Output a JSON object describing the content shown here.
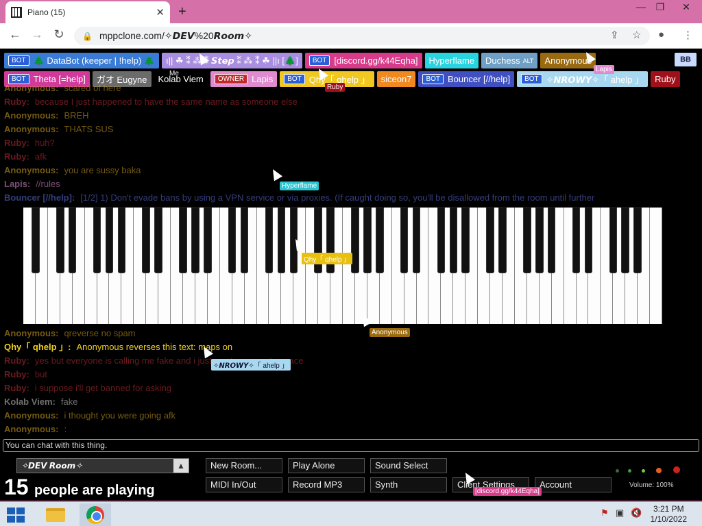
{
  "browser": {
    "tab_title": "Piano (15)",
    "tab_close": "✕",
    "new_tab": "+",
    "url": "mppclone.com/✧𝘿𝙀𝙑%20𝙍𝙤𝙤𝙢✧",
    "window_controls": [
      "—",
      "❐",
      "✕"
    ]
  },
  "players": {
    "row1": [
      {
        "bot": true,
        "name": "🌲 DataBot (keeper | !help) 🌲",
        "color": "#3a7bd5"
      },
      {
        "bot": false,
        "name": "ı|| ☘ ⁑ ⁂ ⁑ 𝙎𝙩𝙚𝙥 ⁑ ⁂ ⁑ ☘ ||ı [🌲]",
        "color": "#a98de0"
      },
      {
        "bot": true,
        "name": "[discord.gg/k44Eqha]",
        "color": "#d83b8a"
      },
      {
        "bot": false,
        "name": "Hyperflame",
        "color": "#29d4e0"
      },
      {
        "bot": false,
        "name": "Duchess",
        "small": "ALT",
        "color": "#6f9fc4"
      },
      {
        "bot": false,
        "name": "Anonymous",
        "color": "#9a6a10"
      }
    ],
    "row2": [
      {
        "bot": true,
        "name": "Theta [=help]",
        "color": "#d03a9a"
      },
      {
        "bot": false,
        "name": "ガオ Eugyne",
        "color": "#6b6b6b"
      },
      {
        "bot": false,
        "name": "Kolab Viem",
        "color": "#000000"
      },
      {
        "bot": false,
        "owner": true,
        "name": "Lapis",
        "color": "#e08ad0"
      },
      {
        "bot": true,
        "name": "Qhy「 qhelp 」",
        "color": "#f0c820"
      },
      {
        "bot": false,
        "name": "siceon7",
        "color": "#f08a20"
      },
      {
        "bot": true,
        "name": "Bouncer [//help]",
        "color": "#4050c0"
      },
      {
        "bot": true,
        "name": "✧𝙉𝙍𝙊𝙒𝙔✧「 ahelp 」",
        "color": "#a8d8f0"
      },
      {
        "bot": false,
        "name": "Ruby",
        "color": "#a0101a"
      }
    ],
    "bot_tag": "BOT",
    "owner_tag": "OWNER",
    "bb_button": "BB"
  },
  "chat": [
    {
      "name": "Anonymous:",
      "text": "scared of here",
      "color": "#d4a520",
      "dim": true
    },
    {
      "name": "Ruby:",
      "text": "because I just happened to have the same name as someone else",
      "color": "#c0303a",
      "dim": true
    },
    {
      "name": "Anonymous:",
      "text": "BREH",
      "color": "#d4a520",
      "dim": true
    },
    {
      "name": "Anonymous:",
      "text": "THATS SUS",
      "color": "#d4a520",
      "dim": true
    },
    {
      "name": "Ruby:",
      "text": "huh?",
      "color": "#c0303a",
      "dim": true
    },
    {
      "name": "Ruby:",
      "text": "afk",
      "color": "#c0303a",
      "dim": true
    },
    {
      "name": "Anonymous:",
      "text": "you are sussy baka",
      "color": "#d4a520",
      "dim": true
    },
    {
      "name": "Lapis:",
      "text": "//rules",
      "color": "#e090d8",
      "dim": true
    },
    {
      "name": "Bouncer [//help]:",
      "text": "[1/2] 1) Don't evade bans by using a VPN service or via proxies. (If caught doing so, you'll be disallowed from the room until further",
      "color": "#6070e0",
      "dim": true
    }
  ],
  "chat_lower": [
    {
      "name": "Anonymous:",
      "text": "qreverse no spam",
      "color": "#d4a520",
      "dim": true
    },
    {
      "name": "Qhy「 qhelp 」:",
      "text": "Anonymous reverses this text: maps on",
      "color": "#f0d020",
      "dim": false
    },
    {
      "name": "Ruby:",
      "text": "yes but everyone is calling me fake and i just wants moments peace",
      "color": "#c0303a",
      "dim": true
    },
    {
      "name": "Ruby:",
      "text": "but",
      "color": "#c0303a",
      "dim": true
    },
    {
      "name": "Ruby:",
      "text": "i suppose i'll get banned for asking",
      "color": "#c0303a",
      "dim": true
    },
    {
      "name": "Kolab Viem:",
      "text": "fake",
      "color": "#cccccc",
      "dim": true
    },
    {
      "name": "Anonymous:",
      "text": "i thought you were going afk",
      "color": "#d4a520",
      "dim": true
    },
    {
      "name": "Anonymous:",
      "text": ":",
      "color": "#d4a520",
      "dim": true
    }
  ],
  "cursors": [
    {
      "label": "Hyperflame",
      "color": "#29c4d0"
    },
    {
      "label": "Qhy「 qhelp 」",
      "color": "#e8c010"
    },
    {
      "label": "Anonymous",
      "color": "#9a6a10"
    },
    {
      "label": "✧𝙉𝙍𝙊𝙒𝙔✧「 ahelp 」",
      "color": "#a8d8f0"
    },
    {
      "label": "[discord.gg/k44Eqha]",
      "color": "#d83b8a"
    },
    {
      "label": "Lapis",
      "color": "#e08ad0"
    },
    {
      "label": "Ruby",
      "color": "#a0101a"
    },
    {
      "label": "Me",
      "color": "#000000"
    }
  ],
  "chat_input_placeholder": "You can chat with this thing.",
  "room": {
    "name": "✧𝘿𝙀𝙑 𝙍𝙤𝙤𝙢✧",
    "arrow": "▲"
  },
  "people": {
    "count": "15",
    "text": "people are playing"
  },
  "buttons": {
    "new_room": "New Room...",
    "play_alone": "Play Alone",
    "sound_select": "Sound Select",
    "midi": "MIDI In/Out",
    "record": "Record MP3",
    "synth": "Synth",
    "client_settings": "Client Settings",
    "account": "Account"
  },
  "volume": "Volume: 100%",
  "clock": {
    "time": "3:21 PM",
    "date": "1/10/2022"
  }
}
